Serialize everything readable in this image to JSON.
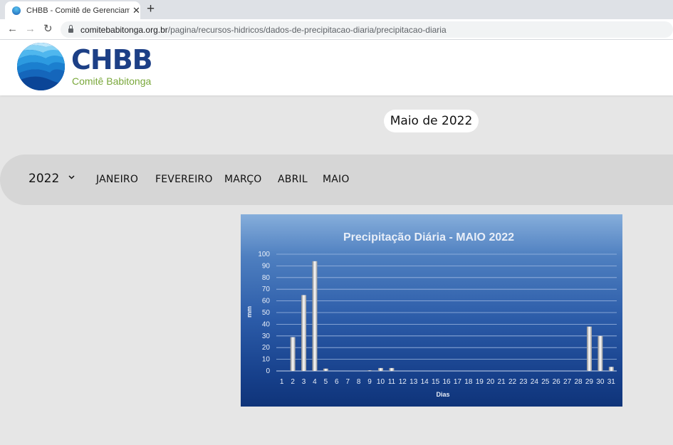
{
  "browser": {
    "tab_title": "CHBB - Comitê de Gerenciamento",
    "tab_close": "✕",
    "new_tab": "+",
    "url_host": "comitebabitonga.org.br",
    "url_path": "/pagina/recursos-hidricos/dados-de-precipitacao-diaria/precipitacao-diaria"
  },
  "site": {
    "logo_title": "CHBB",
    "logo_subtitle": "Comitê Babitonga"
  },
  "page": {
    "month_badge": "Maio de 2022",
    "year": "2022",
    "months": [
      "JANEIRO",
      "FEVEREIRO",
      "MARÇO",
      "ABRIL",
      "MAIO"
    ]
  },
  "chart_data": {
    "type": "bar",
    "title": "Precipitação Diária - MAIO 2022",
    "xlabel": "Dias",
    "ylabel": "mm",
    "ylim": [
      0,
      100
    ],
    "yticks": [
      0,
      10,
      20,
      30,
      40,
      50,
      60,
      70,
      80,
      90,
      100
    ],
    "grid": true,
    "categories": [
      "1",
      "2",
      "3",
      "4",
      "5",
      "6",
      "7",
      "8",
      "9",
      "10",
      "11",
      "12",
      "13",
      "14",
      "15",
      "16",
      "17",
      "18",
      "19",
      "20",
      "21",
      "22",
      "23",
      "24",
      "25",
      "26",
      "27",
      "28",
      "29",
      "30",
      "31"
    ],
    "values": [
      0,
      29,
      65,
      94,
      2,
      0,
      0,
      0,
      0.5,
      2.5,
      2.5,
      0,
      0,
      0,
      0,
      0,
      0,
      0,
      0,
      0,
      0,
      0,
      0,
      0,
      0,
      0,
      0,
      0,
      38,
      30,
      3.5
    ]
  }
}
